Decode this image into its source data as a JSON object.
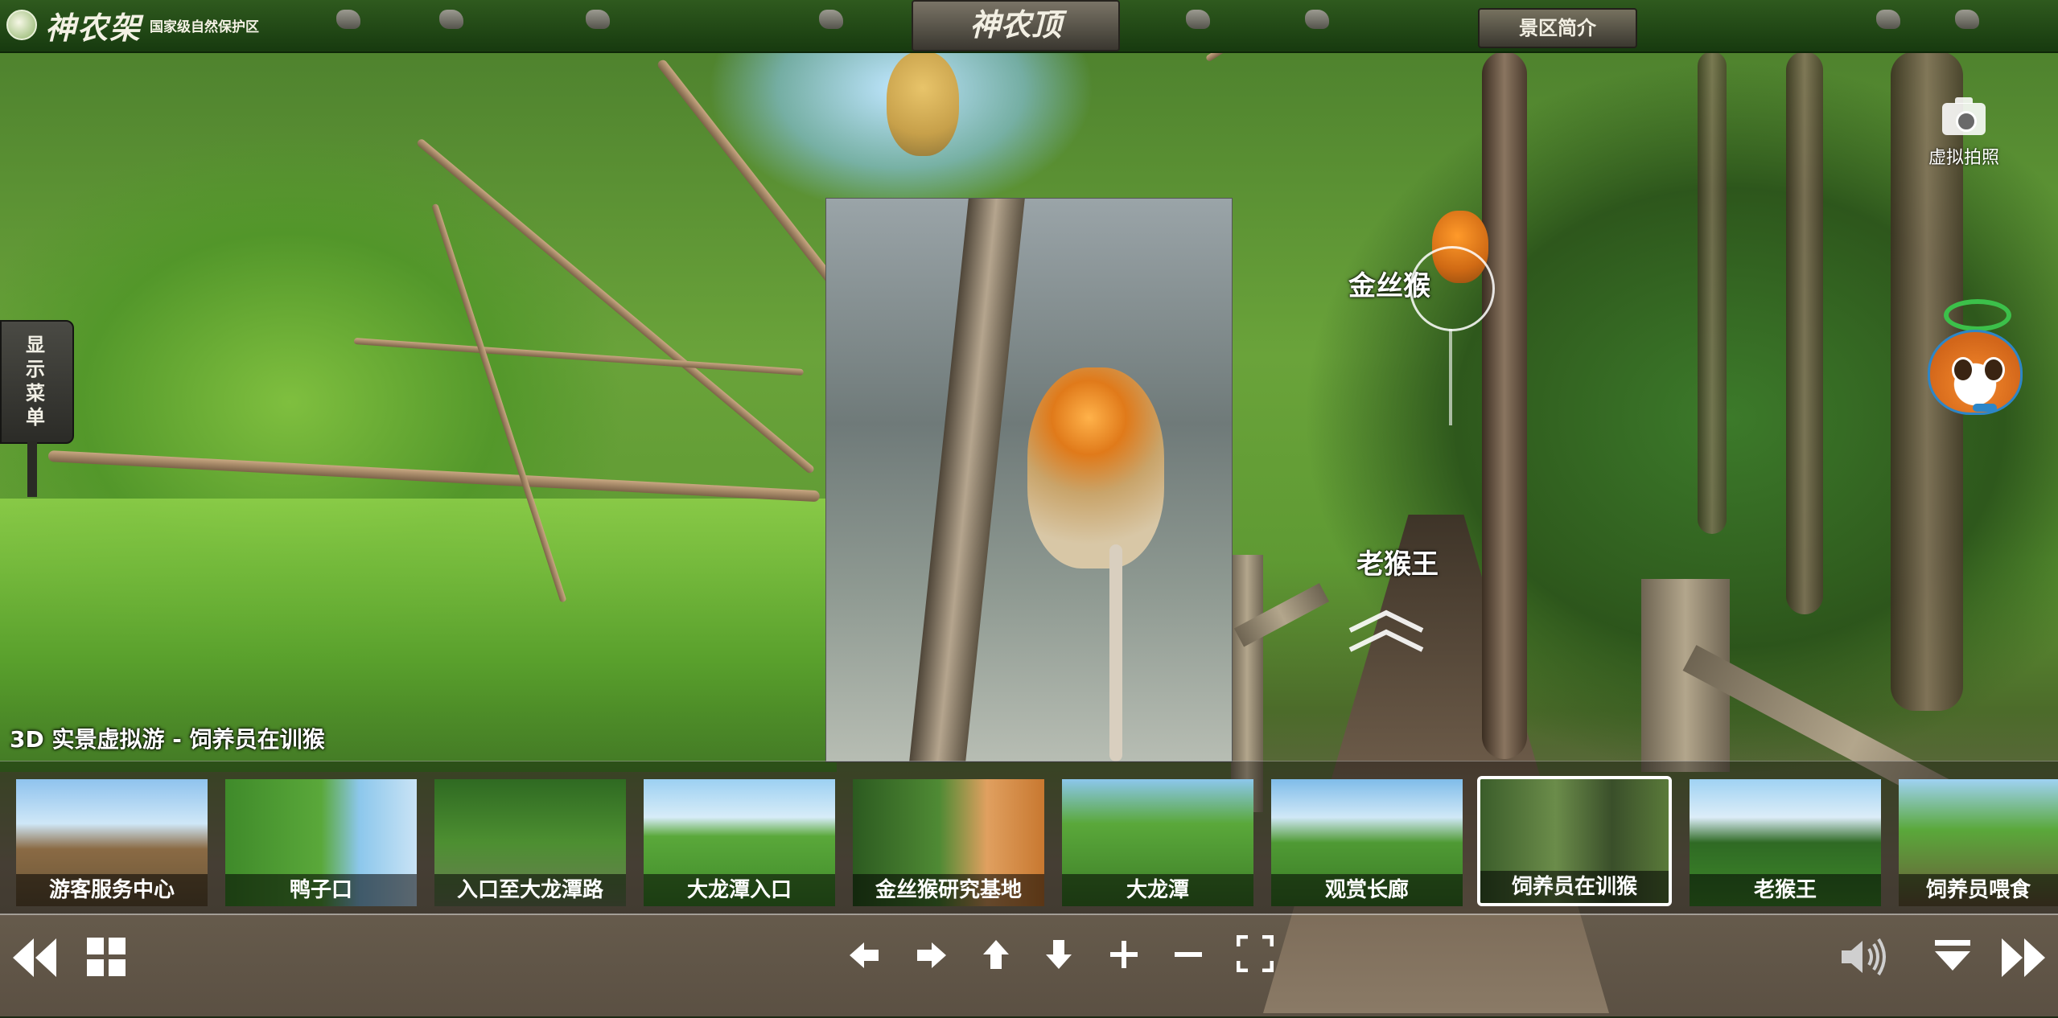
{
  "header": {
    "brand": "神农架",
    "brand_subtitle": "国家级自然保护区",
    "scene_title": "神农顶",
    "intro_label": "景区简介"
  },
  "menu_sign": {
    "label_lines": [
      "显",
      "示",
      "菜",
      "单"
    ]
  },
  "hotspots": [
    {
      "label": "金丝猴"
    },
    {
      "label": "老猴王"
    }
  ],
  "camera": {
    "label": "虚拟拍照",
    "icon": "camera-icon"
  },
  "mascot": {
    "icon": "mascot-icon"
  },
  "caption": "3D 实景虚拟游 - 饲养员在训猴",
  "thumbnails": [
    {
      "label": "游客服务中心"
    },
    {
      "label": "鸭子口"
    },
    {
      "label": "入口至大龙潭路"
    },
    {
      "label": "大龙潭入口"
    },
    {
      "label": "金丝猴研究基地"
    },
    {
      "label": "大龙潭"
    },
    {
      "label": "观赏长廊"
    },
    {
      "label": "饲养员在训猴",
      "active": true
    },
    {
      "label": "老猴王"
    },
    {
      "label": "饲养员喂食"
    }
  ],
  "controls": {
    "icons": [
      "rewind-icon",
      "grid-icon",
      "arrow-left-icon",
      "arrow-right-icon",
      "arrow-up-icon",
      "arrow-down-icon",
      "zoom-in-icon",
      "zoom-out-icon",
      "fullscreen-icon",
      "speaker-icon",
      "collapse-icon",
      "fast-forward-icon"
    ]
  },
  "colors": {
    "topbar": "#1f4514",
    "highlight": "#ffffff"
  }
}
